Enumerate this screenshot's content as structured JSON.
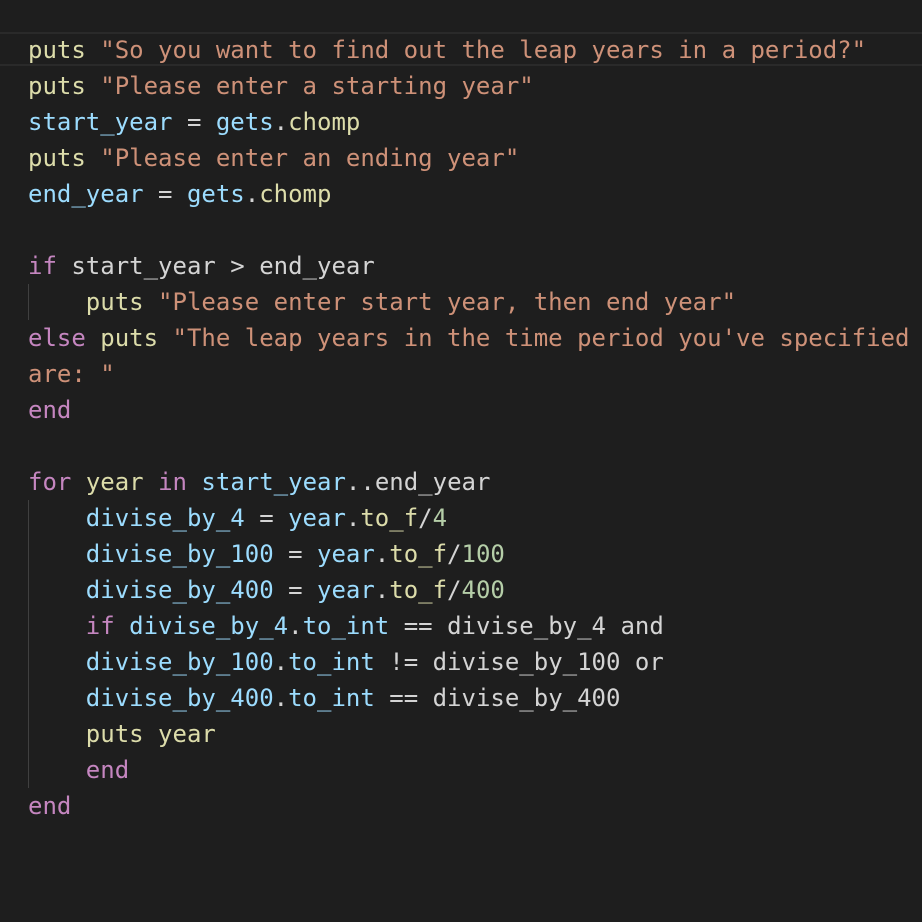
{
  "editor": {
    "colors": {
      "background": "#1e1e1e",
      "keyword": "#c586c0",
      "function": "#dcdcaa",
      "string": "#ce9178",
      "variable": "#9cdcfe",
      "number": "#b5cea8",
      "operator": "#d4d4d4"
    },
    "lines": [
      [
        {
          "c": "fn",
          "t": "puts"
        },
        {
          "c": "op",
          "t": " "
        },
        {
          "c": "str",
          "t": "\"So you want to find out the leap years in a period?\""
        }
      ],
      [
        {
          "c": "fn",
          "t": "puts"
        },
        {
          "c": "op",
          "t": " "
        },
        {
          "c": "str",
          "t": "\"Please enter a starting year\""
        }
      ],
      [
        {
          "c": "var",
          "t": "start_year"
        },
        {
          "c": "op",
          "t": " = "
        },
        {
          "c": "var",
          "t": "gets"
        },
        {
          "c": "op",
          "t": "."
        },
        {
          "c": "fn",
          "t": "chomp"
        }
      ],
      [
        {
          "c": "fn",
          "t": "puts"
        },
        {
          "c": "op",
          "t": " "
        },
        {
          "c": "str",
          "t": "\"Please enter an ending year\""
        }
      ],
      [
        {
          "c": "var",
          "t": "end_year"
        },
        {
          "c": "op",
          "t": " = "
        },
        {
          "c": "var",
          "t": "gets"
        },
        {
          "c": "op",
          "t": "."
        },
        {
          "c": "fn",
          "t": "chomp"
        }
      ],
      [],
      [
        {
          "c": "kw",
          "t": "if"
        },
        {
          "c": "op",
          "t": " start_year > end_year"
        }
      ],
      [
        {
          "c": "op",
          "t": "    "
        },
        {
          "c": "fn",
          "t": "puts"
        },
        {
          "c": "op",
          "t": " "
        },
        {
          "c": "str",
          "t": "\"Please enter start year, then end year\""
        }
      ],
      [
        {
          "c": "kw",
          "t": "else"
        },
        {
          "c": "op",
          "t": " "
        },
        {
          "c": "fn",
          "t": "puts"
        },
        {
          "c": "op",
          "t": " "
        },
        {
          "c": "str",
          "t": "\"The leap years in the time period you've specified"
        }
      ],
      [
        {
          "c": "str",
          "t": "are: \""
        }
      ],
      [
        {
          "c": "kw",
          "t": "end"
        }
      ],
      [],
      [
        {
          "c": "kw",
          "t": "for"
        },
        {
          "c": "op",
          "t": " "
        },
        {
          "c": "fn",
          "t": "year"
        },
        {
          "c": "op",
          "t": " "
        },
        {
          "c": "kw",
          "t": "in"
        },
        {
          "c": "op",
          "t": " "
        },
        {
          "c": "var",
          "t": "start_year"
        },
        {
          "c": "op",
          "t": "..end_year"
        }
      ],
      [
        {
          "c": "op",
          "t": "    "
        },
        {
          "c": "var",
          "t": "divise_by_4"
        },
        {
          "c": "op",
          "t": " = "
        },
        {
          "c": "var",
          "t": "year"
        },
        {
          "c": "op",
          "t": "."
        },
        {
          "c": "fn",
          "t": "to_f"
        },
        {
          "c": "op",
          "t": "/"
        },
        {
          "c": "num",
          "t": "4"
        }
      ],
      [
        {
          "c": "op",
          "t": "    "
        },
        {
          "c": "var",
          "t": "divise_by_100"
        },
        {
          "c": "op",
          "t": " = "
        },
        {
          "c": "var",
          "t": "year"
        },
        {
          "c": "op",
          "t": "."
        },
        {
          "c": "fn",
          "t": "to_f"
        },
        {
          "c": "op",
          "t": "/"
        },
        {
          "c": "num",
          "t": "100"
        }
      ],
      [
        {
          "c": "op",
          "t": "    "
        },
        {
          "c": "var",
          "t": "divise_by_400"
        },
        {
          "c": "op",
          "t": " = "
        },
        {
          "c": "var",
          "t": "year"
        },
        {
          "c": "op",
          "t": "."
        },
        {
          "c": "fn",
          "t": "to_f"
        },
        {
          "c": "op",
          "t": "/"
        },
        {
          "c": "num",
          "t": "400"
        }
      ],
      [
        {
          "c": "op",
          "t": "    "
        },
        {
          "c": "kw",
          "t": "if"
        },
        {
          "c": "op",
          "t": " "
        },
        {
          "c": "var",
          "t": "divise_by_4"
        },
        {
          "c": "op",
          "t": "."
        },
        {
          "c": "var",
          "t": "to_int"
        },
        {
          "c": "op",
          "t": " == divise_by_4 and"
        }
      ],
      [
        {
          "c": "op",
          "t": "    "
        },
        {
          "c": "var",
          "t": "divise_by_100"
        },
        {
          "c": "op",
          "t": "."
        },
        {
          "c": "var",
          "t": "to_int"
        },
        {
          "c": "op",
          "t": " != divise_by_100 or"
        }
      ],
      [
        {
          "c": "op",
          "t": "    "
        },
        {
          "c": "var",
          "t": "divise_by_400"
        },
        {
          "c": "op",
          "t": "."
        },
        {
          "c": "var",
          "t": "to_int"
        },
        {
          "c": "op",
          "t": " == divise_by_400"
        }
      ],
      [
        {
          "c": "op",
          "t": "    "
        },
        {
          "c": "fn",
          "t": "puts"
        },
        {
          "c": "op",
          "t": " "
        },
        {
          "c": "fn",
          "t": "year"
        }
      ],
      [
        {
          "c": "op",
          "t": "    "
        },
        {
          "c": "kw",
          "t": "end"
        }
      ],
      [
        {
          "c": "kw",
          "t": "end"
        }
      ]
    ],
    "indent_guide_lines": [
      7,
      13,
      14,
      15,
      16,
      17,
      18,
      19,
      20
    ]
  }
}
